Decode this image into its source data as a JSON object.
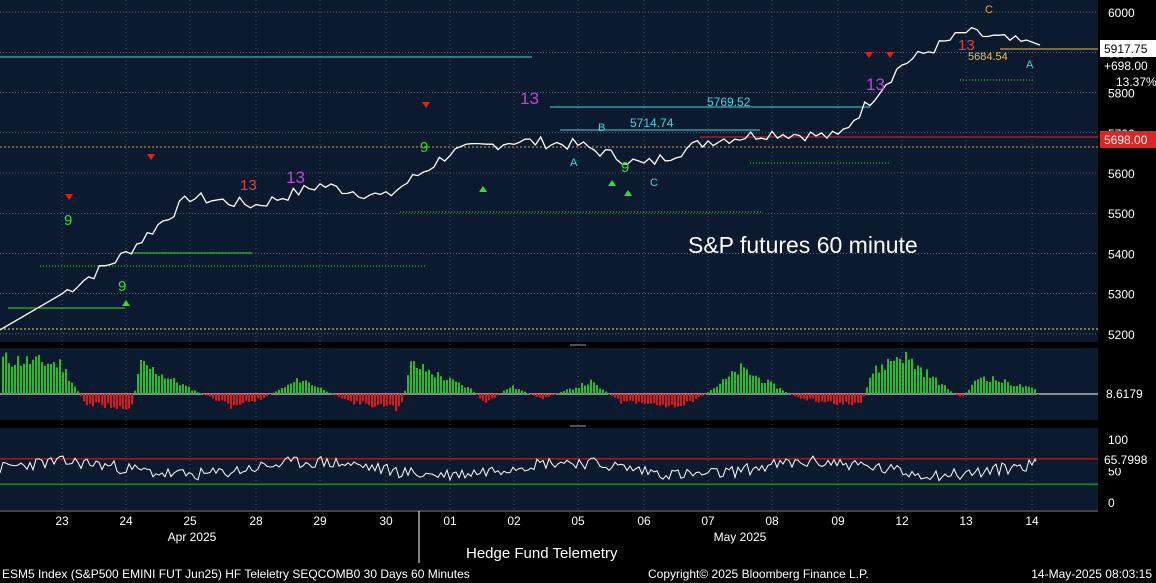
{
  "chart_data": [
    {
      "type": "line",
      "panel": "price",
      "label": "S&P futures 60 minute",
      "x_tick_labels": [
        "23",
        "24",
        "25",
        "28",
        "29",
        "30",
        "01",
        "02",
        "05",
        "06",
        "07",
        "08",
        "09",
        "12",
        "13",
        "14"
      ],
      "x_month_labels": [
        "Apr 2025",
        "May 2025"
      ],
      "ylim": [
        5180,
        6030
      ],
      "y_ticks": [
        5200,
        5300,
        5400,
        5500,
        5600,
        5700,
        5800,
        5900,
        6000
      ],
      "series": [
        {
          "x": [
            "23",
            "24",
            "25",
            "28",
            "29",
            "30",
            "01",
            "02",
            "05",
            "06",
            "07",
            "08",
            "09",
            "12",
            "13",
            "14"
          ],
          "y": [
            5300,
            5400,
            5540,
            5520,
            5570,
            5540,
            5650,
            5680,
            5670,
            5620,
            5680,
            5700,
            5690,
            5870,
            5950,
            5918
          ]
        }
      ],
      "price_label_last": "5917.75",
      "price_label_change": "+698.00",
      "price_label_pct": "13.37%",
      "price_label_level": "5698.00",
      "annotations": [
        "5769.52",
        "5714.74",
        "5684.54",
        "13",
        "13",
        "13",
        "13",
        "13",
        "9",
        "9",
        "9",
        "9",
        "A",
        "B",
        "C",
        "A",
        "C"
      ],
      "grid": true,
      "legend": "none"
    },
    {
      "type": "bar",
      "panel": "oscillator",
      "last_value_label": "8.6179",
      "colors": {
        "positive": "#1fc21f",
        "negative": "#e01717"
      }
    },
    {
      "type": "line",
      "panel": "rsi",
      "ylim": [
        0,
        100
      ],
      "y_ticks": [
        0,
        50,
        100
      ],
      "upper_band": 70,
      "lower_band": 30,
      "last_value_label": "65.7998"
    }
  ],
  "footer": {
    "left": "ESM5 Index (S&P500 EMINI FUT  Jun25) HF Teleletry SEQCOMB0 30 Days 60 Minutes",
    "center_title": "Hedge Fund Telemetry",
    "copyright": "Copyright© 2025 Bloomberg Finance L.P.",
    "timestamp": "14-May-2025 08:03:15"
  },
  "colors": {
    "background": "#000000",
    "panel_bg": "#0b1a2e",
    "grid": "#7f8c9b",
    "price": "#ffffff",
    "cyan": "#3fd9e0",
    "red_level": "#e02424",
    "orange_level": "#e0a030",
    "green": "#2ee02e",
    "magenta": "#c040e0",
    "yellow": "#f0e040"
  }
}
